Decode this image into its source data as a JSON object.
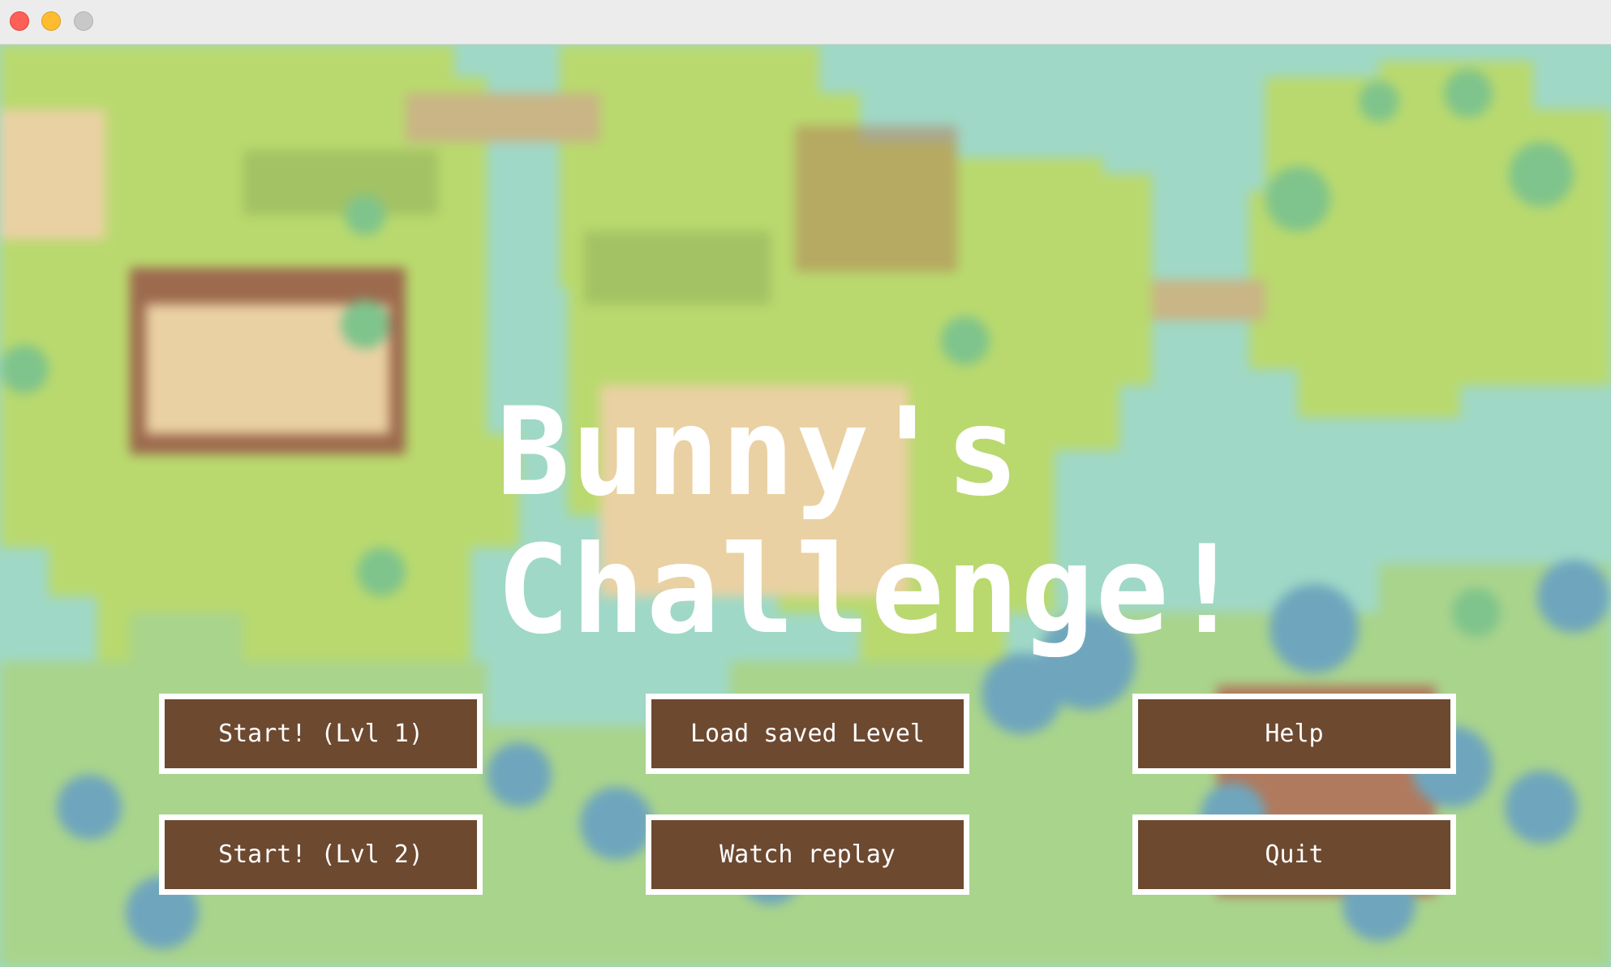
{
  "game": {
    "title": "Bunny's\nChallenge!"
  },
  "menu": {
    "buttons": [
      {
        "label": "Start! (Lvl 1)"
      },
      {
        "label": "Load saved Level"
      },
      {
        "label": "Help"
      },
      {
        "label": "Start! (Lvl 2)"
      },
      {
        "label": "Watch replay"
      },
      {
        "label": "Quit"
      }
    ]
  },
  "colors": {
    "button_fill": "#6d4930",
    "button_border": "#ffffff",
    "title_text": "#ffffff",
    "water": "#9fd8c6",
    "grass": "#b9d96e"
  }
}
